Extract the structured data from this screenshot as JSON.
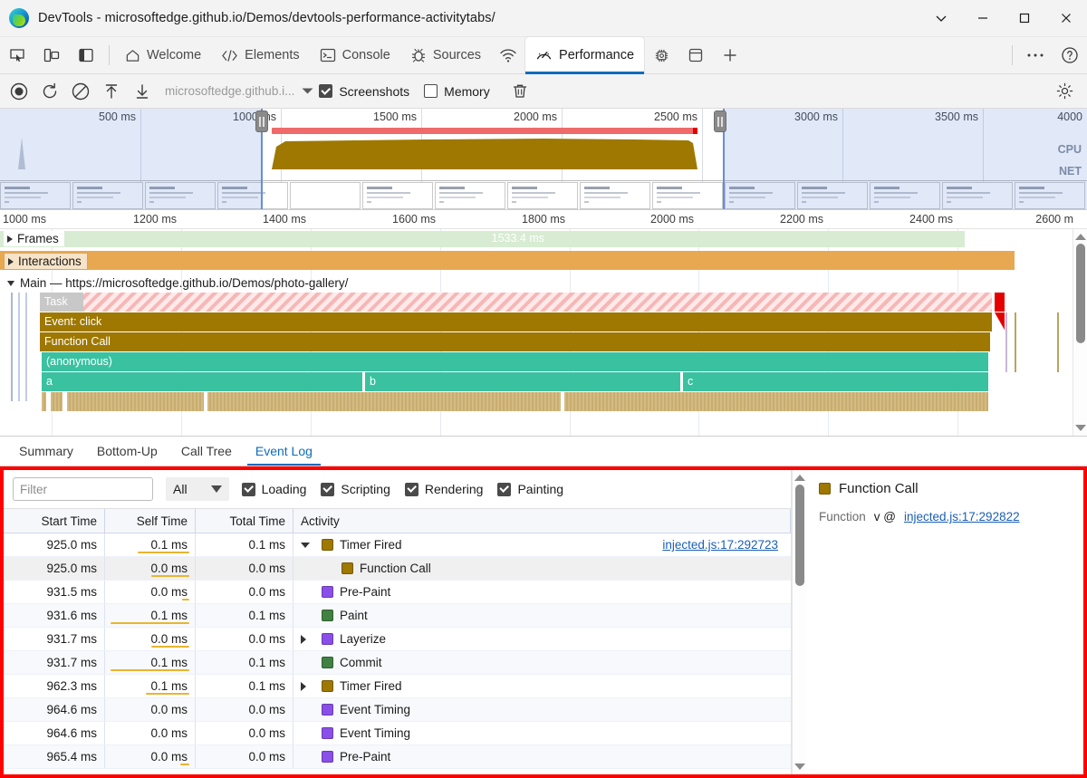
{
  "window": {
    "title": "DevTools - microsoftedge.github.io/Demos/devtools-performance-activitytabs/",
    "controls": {
      "more": "chevron-down",
      "minimize": "minimize",
      "maximize": "maximize",
      "close": "close"
    }
  },
  "tabstrip": {
    "left_icons": [
      "inspect-icon",
      "device-toggle-icon",
      "dock-side-icon"
    ],
    "tabs": [
      {
        "label": "Welcome",
        "icon": "home-icon",
        "active": false
      },
      {
        "label": "Elements",
        "icon": "code-icon",
        "active": false
      },
      {
        "label": "Console",
        "icon": "console-icon",
        "active": false
      },
      {
        "label": "Sources",
        "icon": "bug-icon",
        "active": false
      },
      {
        "label": "",
        "icon": "network-icon",
        "active": false
      },
      {
        "label": "Performance",
        "icon": "gauge-icon",
        "active": true
      },
      {
        "label": "",
        "icon": "memory-icon",
        "active": false
      },
      {
        "label": "",
        "icon": "application-icon",
        "active": false
      },
      {
        "label": "",
        "icon": "plus-icon",
        "active": false
      }
    ],
    "right_icons": [
      "more-options-icon",
      "help-icon"
    ]
  },
  "perftoolbar": {
    "record_label": "record-icon",
    "reload_label": "reload-record-icon",
    "clear_label": "clear-icon",
    "upload_label": "upload-profile-icon",
    "download_label": "download-profile-icon",
    "url": "microsoftedge.github.i...",
    "dropdown_caret": "chevron-down-icon",
    "screenshots": {
      "label": "Screenshots",
      "checked": true
    },
    "memory": {
      "label": "Memory",
      "checked": false
    },
    "trash_label": "delete-icon",
    "settings_label": "gear-icon"
  },
  "overview": {
    "ticks": [
      "500 ms",
      "1000 ms",
      "1500 ms",
      "2000 ms",
      "2500 ms",
      "3000 ms",
      "3500 ms",
      "4000"
    ],
    "cpu_label": "CPU",
    "net_label": "NET",
    "selection_start_ms": 1000,
    "selection_end_ms": 2620,
    "total_ms": 4000
  },
  "timeline": {
    "ticks": [
      "1000 ms",
      "1200 ms",
      "1400 ms",
      "1600 ms",
      "1800 ms",
      "2000 ms",
      "2200 ms",
      "2400 ms",
      "2600 m"
    ],
    "range_start_ms": 960,
    "range_end_ms": 2650,
    "tracks": {
      "frames": {
        "label": "Frames",
        "duration": "1533.4 ms",
        "expanded": false
      },
      "interactions": {
        "label": "Interactions",
        "expanded": false
      },
      "main": {
        "label": "Main — https://microsoftedge.github.io/Demos/photo-gallery/",
        "expanded": true
      }
    },
    "flame_rows": [
      {
        "kind": "task",
        "label": "Task"
      },
      {
        "kind": "gold",
        "label": "Event: click"
      },
      {
        "kind": "gold",
        "label": "Function Call"
      },
      {
        "kind": "teal",
        "label": "(anonymous)"
      },
      {
        "kind": "teal-split",
        "labels": [
          "a",
          "b",
          "c"
        ]
      },
      {
        "kind": "tan",
        "label": ""
      }
    ]
  },
  "bottom_tabs": [
    {
      "label": "Summary",
      "active": false
    },
    {
      "label": "Bottom-Up",
      "active": false
    },
    {
      "label": "Call Tree",
      "active": false
    },
    {
      "label": "Event Log",
      "active": true
    }
  ],
  "eventlog": {
    "filter_placeholder": "Filter",
    "filter_value": "",
    "duration_select": "All",
    "categories": [
      {
        "label": "Loading",
        "checked": true
      },
      {
        "label": "Scripting",
        "checked": true
      },
      {
        "label": "Rendering",
        "checked": true
      },
      {
        "label": "Painting",
        "checked": true
      }
    ],
    "columns": [
      "Start Time",
      "Self Time",
      "Total Time",
      "Activity"
    ],
    "rows": [
      {
        "start": "925.0 ms",
        "self": "0.1 ms",
        "total": "0.1 ms",
        "activity": "Timer Fired",
        "color": "#9e7800",
        "caret": "down",
        "indent": 0,
        "link": "injected.js:17:292723",
        "selfbar": 58,
        "selected": false
      },
      {
        "start": "925.0 ms",
        "self": "0.0 ms",
        "total": "0.0 ms",
        "activity": "Function Call",
        "color": "#9e7800",
        "caret": "none",
        "indent": 1,
        "link": "",
        "selfbar": 42,
        "selected": true
      },
      {
        "start": "931.5 ms",
        "self": "0.0 ms",
        "total": "0.0 ms",
        "activity": "Pre-Paint",
        "color": "#8a4fe8",
        "caret": "none",
        "indent": 0,
        "link": "",
        "selfbar": 8,
        "selected": false
      },
      {
        "start": "931.6 ms",
        "self": "0.1 ms",
        "total": "0.1 ms",
        "activity": "Paint",
        "color": "#418142",
        "caret": "none",
        "indent": 0,
        "link": "",
        "selfbar": 88,
        "selected": false
      },
      {
        "start": "931.7 ms",
        "self": "0.0 ms",
        "total": "0.0 ms",
        "activity": "Layerize",
        "color": "#8a4fe8",
        "caret": "right",
        "indent": 0,
        "link": "",
        "selfbar": 42,
        "selected": false
      },
      {
        "start": "931.7 ms",
        "self": "0.1 ms",
        "total": "0.1 ms",
        "activity": "Commit",
        "color": "#418142",
        "caret": "none",
        "indent": 0,
        "link": "",
        "selfbar": 88,
        "selected": false
      },
      {
        "start": "962.3 ms",
        "self": "0.1 ms",
        "total": "0.1 ms",
        "activity": "Timer Fired",
        "color": "#9e7800",
        "caret": "right",
        "indent": 0,
        "link": "",
        "selfbar": 48,
        "selected": false
      },
      {
        "start": "964.6 ms",
        "self": "0.0 ms",
        "total": "0.0 ms",
        "activity": "Event Timing",
        "color": "#8a4fe8",
        "caret": "none",
        "indent": 0,
        "link": "",
        "selfbar": 0,
        "selected": false
      },
      {
        "start": "964.6 ms",
        "self": "0.0 ms",
        "total": "0.0 ms",
        "activity": "Event Timing",
        "color": "#8a4fe8",
        "caret": "none",
        "indent": 0,
        "link": "",
        "selfbar": 0,
        "selected": false
      },
      {
        "start": "965.4 ms",
        "self": "0.0 ms",
        "total": "0.0 ms",
        "activity": "Pre-Paint",
        "color": "#8a4fe8",
        "caret": "none",
        "indent": 0,
        "link": "",
        "selfbar": 10,
        "selected": false
      }
    ]
  },
  "details": {
    "title": "Function Call",
    "title_color": "#9e7800",
    "function_key": "Function",
    "function_value": "v @",
    "function_link": "injected.js:17:292822"
  },
  "colors": {
    "accent": "#0f6cbd",
    "highlight_border": "#ff0000",
    "link": "#1a5fb4",
    "scripting": "#9e7800",
    "rendering": "#8a4fe8",
    "painting": "#418142",
    "teal": "#3ac1a0"
  }
}
